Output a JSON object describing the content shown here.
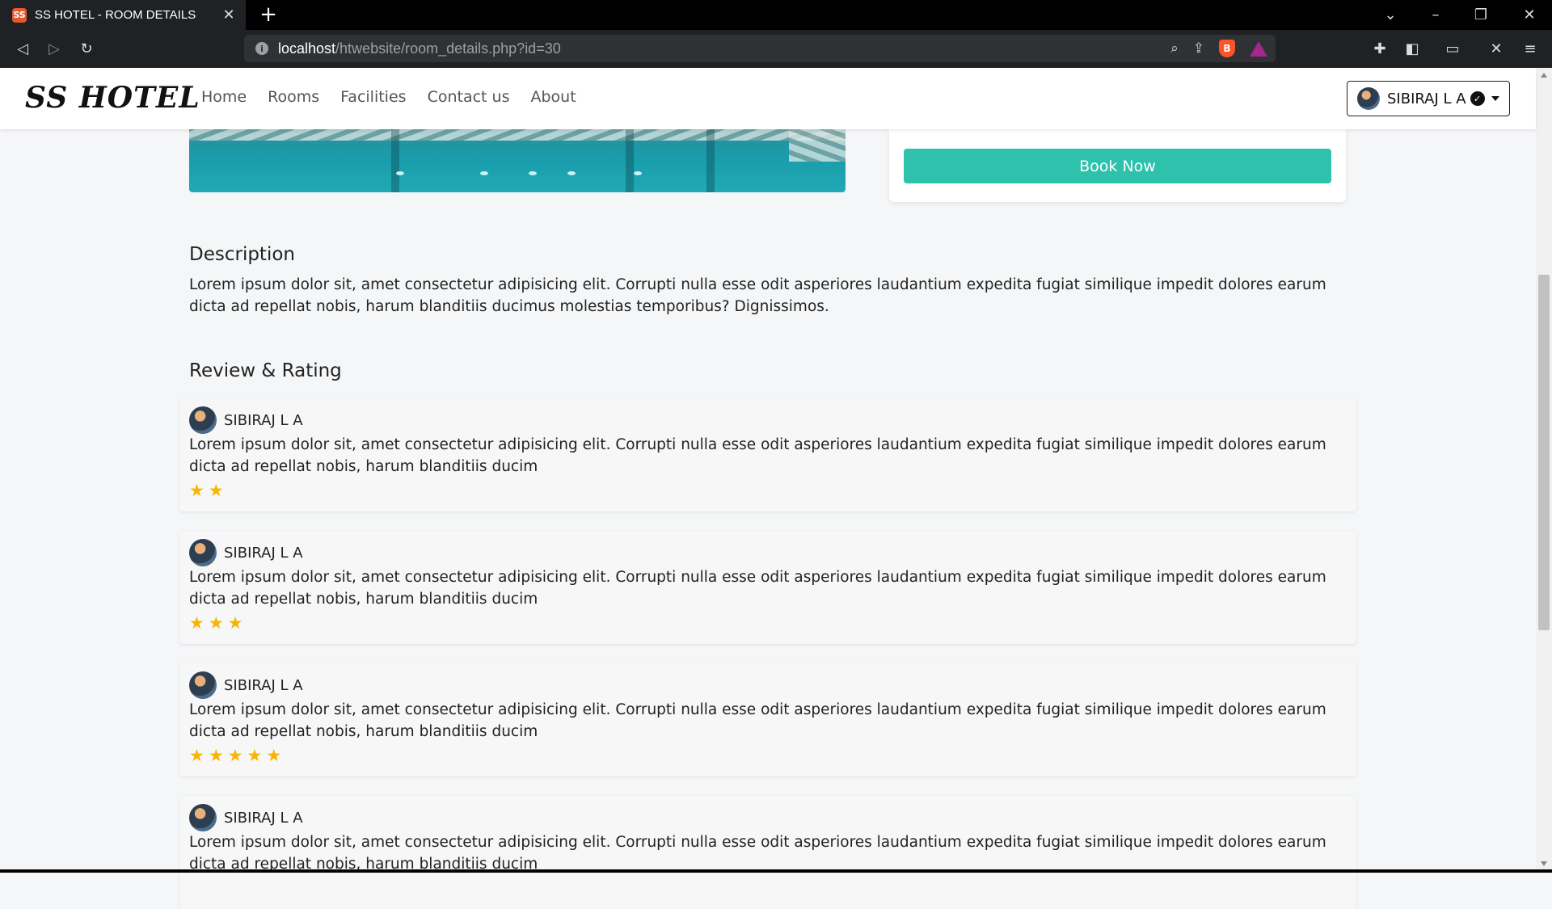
{
  "browser": {
    "tab_title": "SS HOTEL - ROOM DETAILS",
    "favicon": "favicon-icon",
    "url_host": "localhost",
    "url_path": "/htwebsite/room_details.php?id=30"
  },
  "nav": {
    "brand": "SS HOTEL",
    "links": [
      "Home",
      "Rooms",
      "Facilities",
      "Contact us",
      "About"
    ],
    "user": "SIBIRAJ L A"
  },
  "booking": {
    "book_label": "Book Now",
    "accent": "#2ec1ac"
  },
  "description": {
    "title": "Description",
    "text": "Lorem ipsum dolor sit, amet consectetur adipisicing elit. Corrupti nulla esse odit asperiores laudantium expedita fugiat similique impedit dolores earum dicta ad repellat nobis, harum blanditiis ducimus molestias temporibus? Dignissimos."
  },
  "reviews": {
    "title": "Review & Rating",
    "items": [
      {
        "name": "SIBIRAJ L A",
        "text": "Lorem ipsum dolor sit, amet consectetur adipisicing elit. Corrupti nulla esse odit asperiores laudantium expedita fugiat similique impedit dolores earum dicta ad repellat nobis, harum blanditiis ducim",
        "rating": 2
      },
      {
        "name": "SIBIRAJ L A",
        "text": "Lorem ipsum dolor sit, amet consectetur adipisicing elit. Corrupti nulla esse odit asperiores laudantium expedita fugiat similique impedit dolores earum dicta ad repellat nobis, harum blanditiis ducim",
        "rating": 3
      },
      {
        "name": "SIBIRAJ L A",
        "text": "Lorem ipsum dolor sit, amet consectetur adipisicing elit. Corrupti nulla esse odit asperiores laudantium expedita fugiat similique impedit dolores earum dicta ad repellat nobis, harum blanditiis ducim",
        "rating": 5
      },
      {
        "name": "SIBIRAJ L A",
        "text": "Lorem ipsum dolor sit, amet consectetur adipisicing elit. Corrupti nulla esse odit asperiores laudantium expedita fugiat similique impedit dolores earum dicta ad repellat nobis, harum blanditiis ducim",
        "rating": null
      }
    ],
    "star_color": "#f7b500"
  }
}
